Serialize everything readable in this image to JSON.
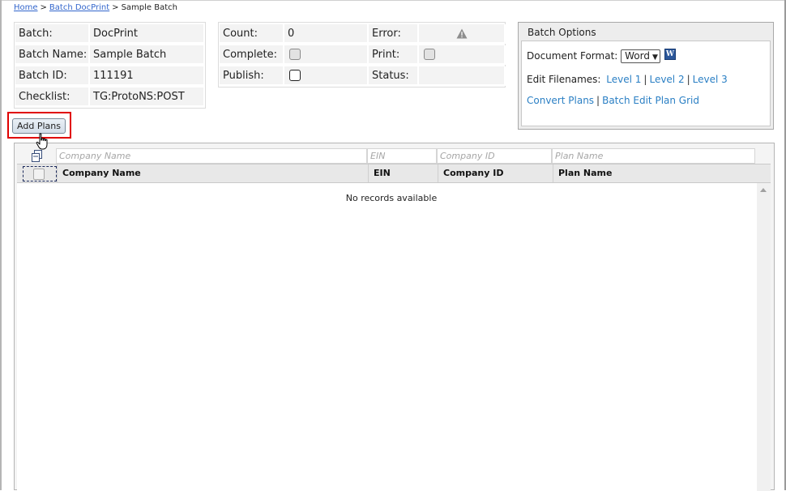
{
  "breadcrumb": {
    "home": "Home",
    "sep1": ">",
    "batch_docprint": "Batch DocPrint",
    "sep2": ">",
    "current": "Sample Batch"
  },
  "batch_info": {
    "batch_label": "Batch:",
    "batch_value": "DocPrint",
    "name_label": "Batch Name:",
    "name_value": "Sample Batch",
    "id_label": "Batch ID:",
    "id_value": "111191",
    "checklist_label": "Checklist:",
    "checklist_value": "TG:ProtoNS:POST"
  },
  "status_info": {
    "count_label": "Count:",
    "count_value": "0",
    "complete_label": "Complete:",
    "complete_checked": false,
    "publish_label": "Publish:",
    "publish_checked": false,
    "error_label": "Error:",
    "error_icon": "warning-triangle-icon",
    "print_label": "Print:",
    "print_checked": false,
    "status_label": "Status:",
    "status_value": ""
  },
  "batch_options": {
    "title": "Batch Options",
    "document_format_label": "Document Format:",
    "document_format_value": "Word",
    "document_format_icon": "word-doc-icon",
    "edit_filenames_label": "Edit Filenames:",
    "levels": [
      "Level 1",
      "Level 2",
      "Level 3"
    ],
    "convert_plans": "Convert Plans",
    "batch_edit_plan_grid": "Batch Edit Plan Grid"
  },
  "actions": {
    "add_plans": "Add Plans"
  },
  "grid": {
    "filter_placeholders": [
      "Company Name",
      "EIN",
      "Company ID",
      "Plan Name"
    ],
    "columns": [
      "Company Name",
      "EIN",
      "Company ID",
      "Plan Name"
    ],
    "empty_message": "No records available"
  },
  "colors": {
    "link": "#3366cc",
    "option_link": "#2a7fc4",
    "highlight": "#e00000",
    "cell_bg": "#f3f3f3"
  }
}
